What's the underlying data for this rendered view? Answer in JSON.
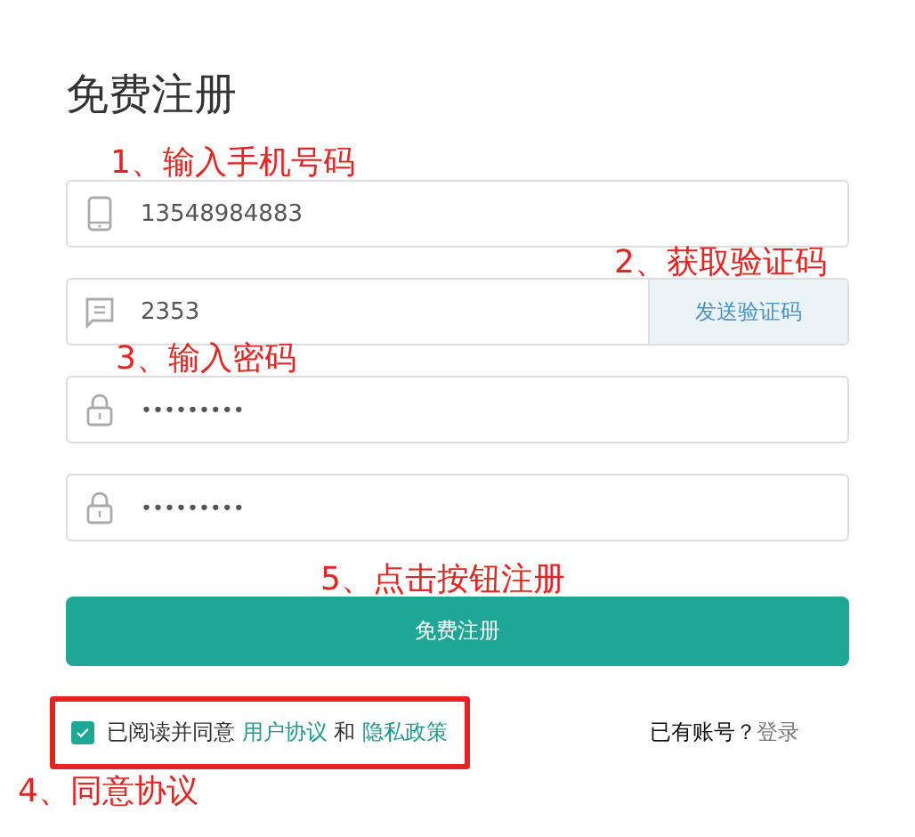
{
  "title": "免费注册",
  "fields": [
    {
      "kind": "phone",
      "value": "13548984883"
    },
    {
      "kind": "sms",
      "value": "2353",
      "button": "发送验证码"
    },
    {
      "kind": "password",
      "value": "•••••••••"
    },
    {
      "kind": "password",
      "value": "•••••••••"
    }
  ],
  "submit": "免费注册",
  "agreement": {
    "checked": true,
    "highlighted": true,
    "text": "已阅读并同意",
    "link_1": "用户协议",
    "joiner": "和",
    "link_2": "隐私政策"
  },
  "login": {
    "prompt": "已有账号？",
    "link": "登录"
  },
  "annotations": [
    {
      "text": "1、输入手机号码"
    },
    {
      "text": "2、获取验证码"
    },
    {
      "text": "3、输入密码"
    },
    {
      "text": "5、点击按钮注册"
    },
    {
      "text": "4、同意协议"
    }
  ]
}
